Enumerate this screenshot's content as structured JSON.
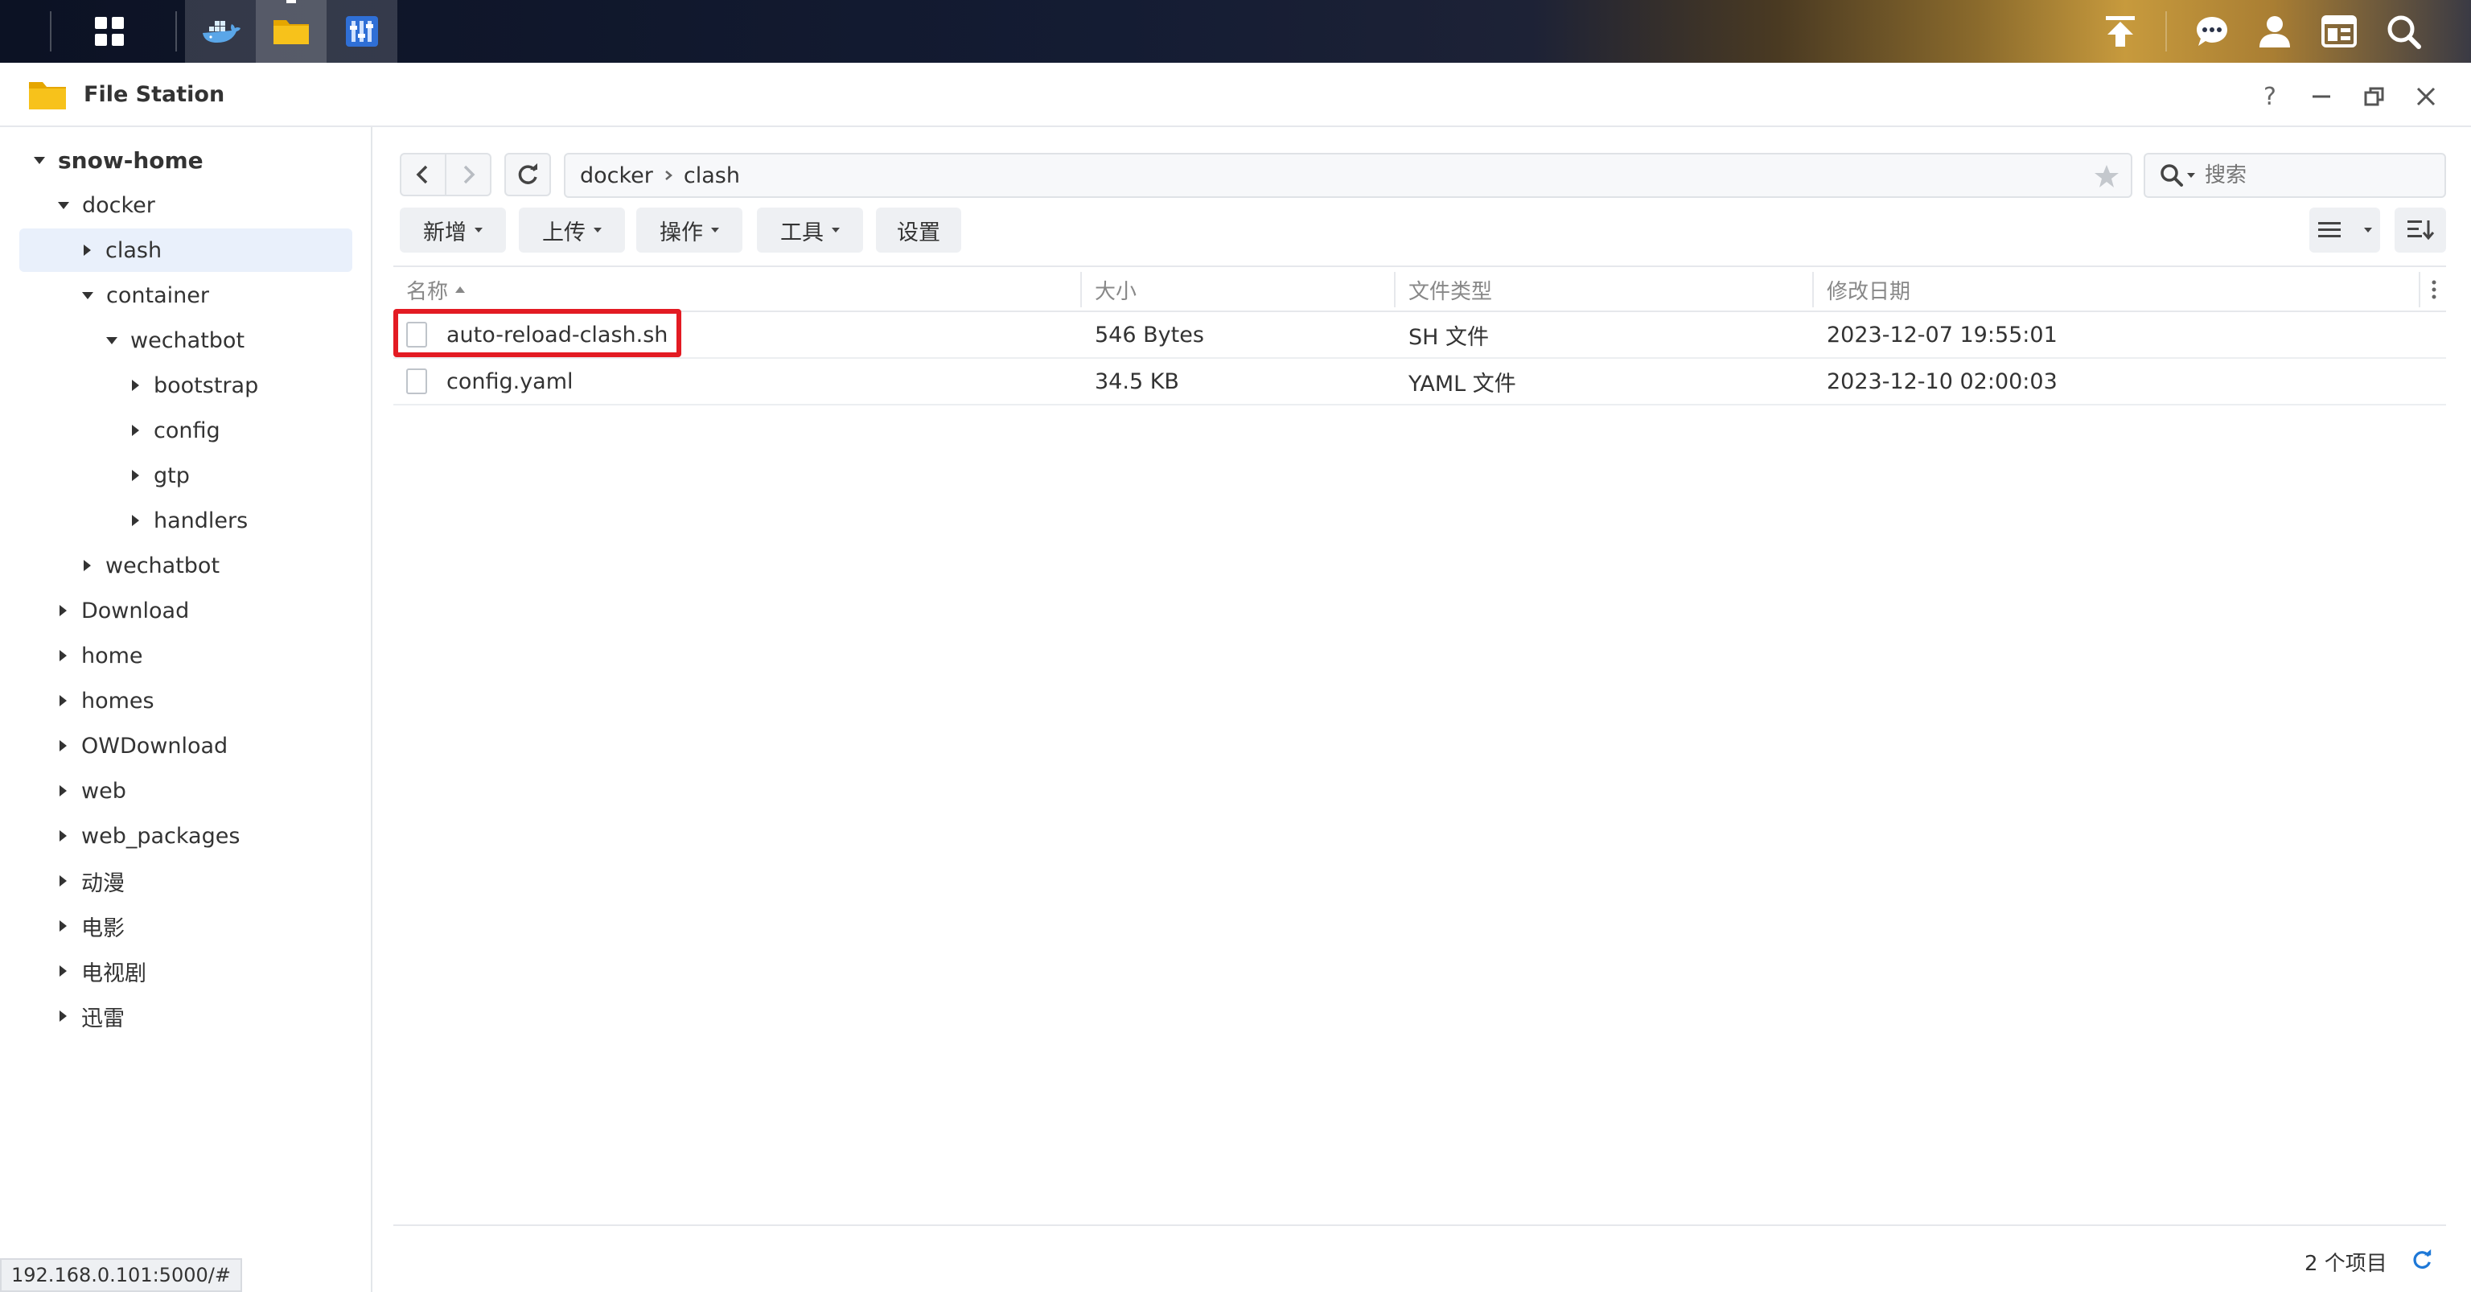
{
  "window": {
    "title": "File Station"
  },
  "sidebar": {
    "items": [
      {
        "label": "snow-home",
        "depth": 0,
        "state": "expanded"
      },
      {
        "label": "docker",
        "depth": 1,
        "state": "expanded"
      },
      {
        "label": "clash",
        "depth": 2,
        "state": "collapsed",
        "selected": true
      },
      {
        "label": "container",
        "depth": 2,
        "state": "expanded"
      },
      {
        "label": "wechatbot",
        "depth": 3,
        "state": "expanded"
      },
      {
        "label": "bootstrap",
        "depth": 4,
        "state": "collapsed"
      },
      {
        "label": "config",
        "depth": 4,
        "state": "collapsed"
      },
      {
        "label": "gtp",
        "depth": 4,
        "state": "collapsed"
      },
      {
        "label": "handlers",
        "depth": 4,
        "state": "collapsed"
      },
      {
        "label": "wechatbot",
        "depth": 2,
        "state": "collapsed"
      },
      {
        "label": "Download",
        "depth": 1,
        "state": "collapsed"
      },
      {
        "label": "home",
        "depth": 1,
        "state": "collapsed"
      },
      {
        "label": "homes",
        "depth": 1,
        "state": "collapsed"
      },
      {
        "label": "OWDownload",
        "depth": 1,
        "state": "collapsed"
      },
      {
        "label": "web",
        "depth": 1,
        "state": "collapsed"
      },
      {
        "label": "web_packages",
        "depth": 1,
        "state": "collapsed"
      },
      {
        "label": "动漫",
        "depth": 1,
        "state": "collapsed"
      },
      {
        "label": "电影",
        "depth": 1,
        "state": "collapsed"
      },
      {
        "label": "电视剧",
        "depth": 1,
        "state": "collapsed"
      },
      {
        "label": "迅雷",
        "depth": 1,
        "state": "collapsed"
      }
    ]
  },
  "path": {
    "segments": [
      "docker",
      "clash"
    ]
  },
  "search": {
    "placeholder": "搜索"
  },
  "toolbar": {
    "new_label": "新增",
    "upload_label": "上传",
    "action_label": "操作",
    "tools_label": "工具",
    "settings_label": "设置"
  },
  "table": {
    "columns": [
      "名称",
      "大小",
      "文件类型",
      "修改日期"
    ],
    "rows": [
      {
        "name": "auto-reload-clash.sh",
        "size": "546 Bytes",
        "type": "SH 文件",
        "modified": "2023-12-07 19:55:01",
        "highlighted": true
      },
      {
        "name": "config.yaml",
        "size": "34.5 KB",
        "type": "YAML 文件",
        "modified": "2023-12-10 02:00:03",
        "highlighted": false
      }
    ]
  },
  "footer": {
    "item_count": "2 个项目"
  },
  "status_bar": {
    "url": "192.168.0.101:5000/#"
  },
  "colors": {
    "highlight": "#e31b23",
    "selection": "#e9f0fb",
    "accent": "#1e78d7"
  }
}
